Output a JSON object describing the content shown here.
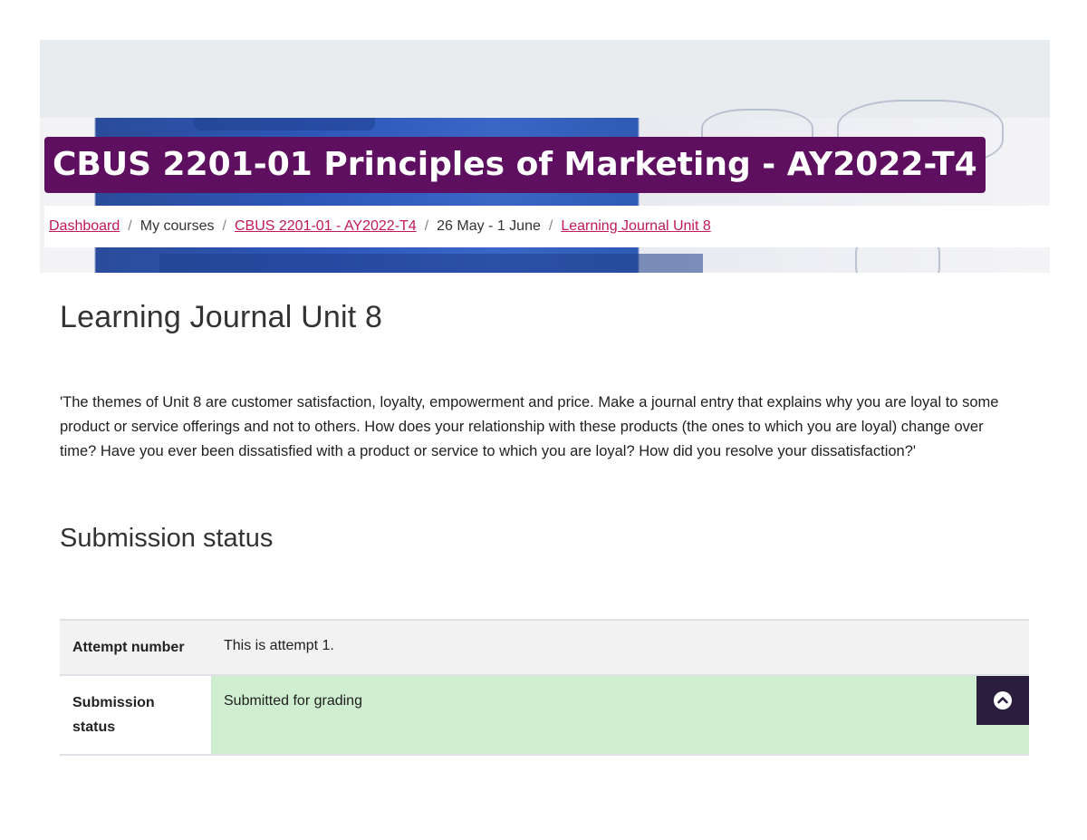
{
  "header": {
    "course_title": "CBUS 2201-01 Principles of Marketing - AY2022-T4"
  },
  "breadcrumb": {
    "items": [
      {
        "label": "Dashboard",
        "link": true
      },
      {
        "label": "My courses",
        "link": false
      },
      {
        "label": "CBUS 2201-01 - AY2022-T4",
        "link": true
      },
      {
        "label": "26 May - 1 June",
        "link": false
      },
      {
        "label": "Learning Journal Unit 8",
        "link": true
      }
    ],
    "separator": "/"
  },
  "main": {
    "page_title": "Learning Journal Unit 8",
    "intro": "'The themes of Unit 8 are customer satisfaction, loyalty, empowerment and price. Make a journal entry that explains why you are loyal to some product or service offerings and not to others. How does your relationship with these products (the ones to which you are loyal) change over time? Have you ever been dissatisfied with a product or service to which you are loyal? How did you resolve your dissatisfaction?'",
    "section_title": "Submission status"
  },
  "submission_table": {
    "rows": [
      {
        "label": "Attempt number",
        "value": "This is attempt 1."
      },
      {
        "label": "Submission status",
        "value": "Submitted for grading"
      }
    ]
  },
  "colors": {
    "title_bg": "#5e0f5f",
    "link": "#c2185b",
    "submitted_bg": "#cfeecf",
    "back_to_top_bg": "#2a1d3e"
  },
  "icons": {
    "back_to_top": "chevron-up-circle-icon"
  }
}
